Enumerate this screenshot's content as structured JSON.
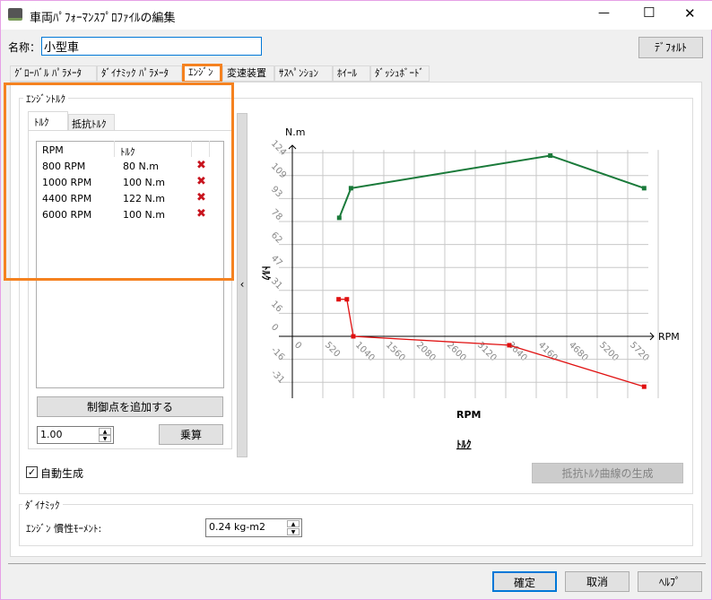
{
  "window": {
    "title": "車両ﾊﾟﾌｫｰﾏﾝｽﾌﾟﾛﾌｧｲﾙの編集",
    "minimize": "—",
    "maximize": "☐",
    "close": "✕"
  },
  "name_label": "名称：",
  "name_value": "小型車",
  "default_button": "ﾃﾞﾌｫﾙﾄ",
  "tabs": [
    "ｸﾞﾛｰﾊﾞﾙ ﾊﾟﾗﾒｰﾀ",
    "ﾀﾞｲﾅﾐｯｸ ﾊﾟﾗﾒｰﾀ",
    "ｴﾝｼﾞﾝ",
    "変速装置",
    "ｻｽﾍﾟﾝｼｮﾝ",
    "ﾎｲｰﾙ",
    "ﾀﾞｯｼｭﾎﾞｰﾄﾞ"
  ],
  "active_tab": "ｴﾝｼﾞﾝ",
  "highlight_color": "#f58220",
  "engine_torque": {
    "group_label": "ｴﾝｼﾞﾝﾄﾙｸ",
    "subtabs": [
      "ﾄﾙｸ",
      "抵抗ﾄﾙｸ"
    ],
    "columns": [
      "RPM",
      "ﾄﾙｸ"
    ],
    "rows": [
      {
        "rpm": "800 RPM",
        "torque": "80 N.m"
      },
      {
        "rpm": "1000 RPM",
        "torque": "100 N.m"
      },
      {
        "rpm": "4400 RPM",
        "torque": "122 N.m"
      },
      {
        "rpm": "6000 RPM",
        "torque": "100 N.m"
      }
    ],
    "add_point_button": "制御点を追加する",
    "multiplier_value": "1.00",
    "multiply_button": "乗算",
    "collapse_glyph": "‹"
  },
  "auto_generate": {
    "label": "自動生成",
    "checked": true
  },
  "resist_curve_button": "抵抗ﾄﾙｸ曲線の生成",
  "dynamic": {
    "group_label": "ﾀﾞｲﾅﾐｯｸ",
    "inertia_label": "ｴﾝｼﾞﾝ 慣性ﾓｰﾒﾝﾄ:",
    "inertia_value": "0.24 kg-m2"
  },
  "footer": {
    "ok": "確定",
    "cancel": "取消",
    "help": "ﾍﾙﾌﾟ"
  },
  "chart_data": {
    "type": "line",
    "title": "ﾄﾙｸ",
    "xlabel": "RPM",
    "ylabel": "ﾄﾙｸ",
    "y_unit": "N.m",
    "x_axis_end_label": "RPM",
    "xlim": [
      0,
      6240
    ],
    "ylim": [
      -40,
      124
    ],
    "x_ticks": [
      "0",
      "520",
      "1040",
      "1560",
      "2080",
      "2600",
      "3120",
      "3640",
      "4160",
      "4680",
      "5200",
      "5720"
    ],
    "x_tick_values": [
      0,
      520,
      1040,
      1560,
      2080,
      2600,
      3120,
      3640,
      4160,
      4680,
      5200,
      5720
    ],
    "y_ticks": [
      "124",
      "109",
      "93",
      "78",
      "62",
      "47",
      "31",
      "16",
      "0",
      "-16",
      "-31"
    ],
    "y_tick_values": [
      124,
      108.5,
      93,
      77.5,
      62,
      46.5,
      31,
      15.5,
      0,
      -15.5,
      -31
    ],
    "grid": true,
    "series": [
      {
        "name": "ﾄﾙｸ",
        "color": "#1a7a3a",
        "points": [
          [
            800,
            80
          ],
          [
            1000,
            100
          ],
          [
            4400,
            122
          ],
          [
            6000,
            100
          ]
        ]
      },
      {
        "name": "抵抗ﾄﾙｸ",
        "color": "#e01010",
        "points": [
          [
            790,
            25
          ],
          [
            930,
            25
          ],
          [
            1040,
            0
          ],
          [
            3700,
            -6
          ],
          [
            6000,
            -34
          ]
        ]
      }
    ]
  }
}
